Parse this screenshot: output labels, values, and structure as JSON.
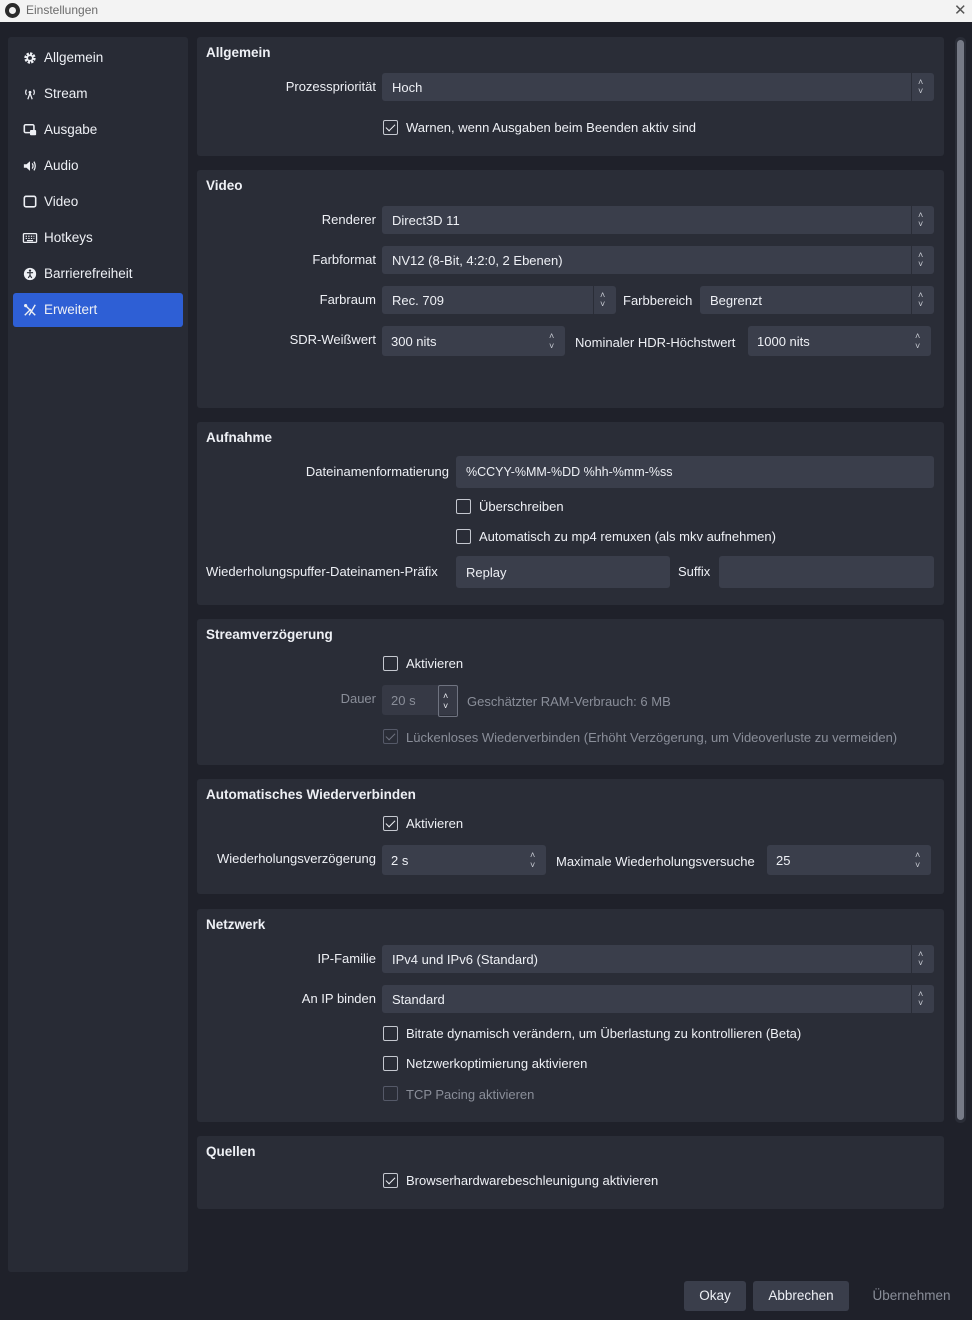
{
  "window": {
    "title": "Einstellungen",
    "close_glyph": "✕"
  },
  "sidebar": {
    "items": [
      {
        "label": "Allgemein",
        "icon": "gear-icon"
      },
      {
        "label": "Stream",
        "icon": "antenna-icon"
      },
      {
        "label": "Ausgabe",
        "icon": "output-icon"
      },
      {
        "label": "Audio",
        "icon": "speaker-icon"
      },
      {
        "label": "Video",
        "icon": "monitor-icon"
      },
      {
        "label": "Hotkeys",
        "icon": "keyboard-icon"
      },
      {
        "label": "Barrierefreiheit",
        "icon": "accessibility-icon"
      },
      {
        "label": "Erweitert",
        "icon": "tools-icon",
        "active": true
      }
    ]
  },
  "general": {
    "title": "Allgemein",
    "priority_label": "Prozesspriorität",
    "priority_value": "Hoch",
    "warn_label": "Warnen, wenn Ausgaben beim Beenden aktiv sind"
  },
  "video": {
    "title": "Video",
    "renderer_label": "Renderer",
    "renderer_value": "Direct3D 11",
    "color_format_label": "Farbformat",
    "color_format_value": "NV12 (8-Bit, 4:2:0, 2 Ebenen)",
    "color_space_label": "Farbraum",
    "color_space_value": "Rec. 709",
    "color_range_label": "Farbbereich",
    "color_range_value": "Begrenzt",
    "sdr_label": "SDR-Weißwert",
    "sdr_value": "300 nits",
    "hdr_label": "Nominaler HDR-Höchstwert",
    "hdr_value": "1000 nits"
  },
  "recording": {
    "title": "Aufnahme",
    "filename_label": "Dateinamenformatierung",
    "filename_value": "%CCYY-%MM-%DD %hh-%mm-%ss",
    "overwrite_label": "Überschreiben",
    "remux_label": "Automatisch zu mp4 remuxen (als mkv aufnehmen)",
    "replay_prefix_label": "Wiederholungspuffer-Dateinamen-Präfix",
    "replay_prefix_value": "Replay",
    "suffix_label": "Suffix",
    "suffix_value": ""
  },
  "stream_delay": {
    "title": "Streamverzögerung",
    "enable_label": "Aktivieren",
    "duration_label": "Dauer",
    "duration_value": "20 s",
    "ram_estimate": "Geschätzter RAM-Verbrauch: 6 MB",
    "preserve_label": "Lückenloses Wiederverbinden (Erhöht Verzögerung, um Videoverluste zu vermeiden)"
  },
  "reconnect": {
    "title": "Automatisches Wiederverbinden",
    "enable_label": "Aktivieren",
    "retry_delay_label": "Wiederholungsverzögerung",
    "retry_delay_value": "2 s",
    "max_retries_label": "Maximale Wiederholungsversuche",
    "max_retries_value": "25"
  },
  "network": {
    "title": "Netzwerk",
    "ip_family_label": "IP-Familie",
    "ip_family_value": "IPv4 und IPv6 (Standard)",
    "bind_ip_label": "An IP binden",
    "bind_ip_value": "Standard",
    "dynamic_bitrate_label": "Bitrate dynamisch verändern, um Überlastung zu kontrollieren (Beta)",
    "net_opt_label": "Netzwerkoptimierung aktivieren",
    "tcp_pacing_label": "TCP Pacing aktivieren"
  },
  "sources": {
    "title": "Quellen",
    "browser_hw_label": "Browserhardwarebeschleunigung aktivieren"
  },
  "buttons": {
    "ok": "Okay",
    "cancel": "Abbrechen",
    "apply": "Übernehmen"
  },
  "glyphs": {
    "up": "˄",
    "down": "˅"
  }
}
